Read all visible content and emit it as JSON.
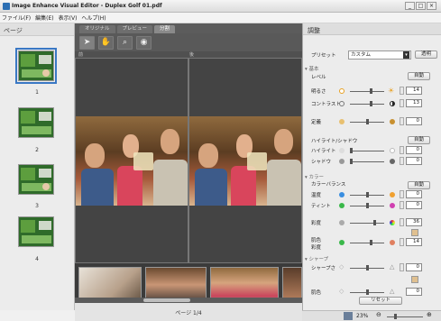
{
  "window": {
    "title": "Image Enhance Visual Editor - Duplex Golf 01.pdf"
  },
  "menu": {
    "items": [
      "ファイル(F)",
      "編集(E)",
      "表示(V)",
      "ヘルプ(H)"
    ]
  },
  "left_panel": {
    "title": "ページ",
    "pages": [
      "1",
      "2",
      "3",
      "4"
    ]
  },
  "center": {
    "tabs": [
      "オリジナル",
      "プレビュー",
      "分割"
    ],
    "ruler": {
      "left": "前",
      "right": "後"
    },
    "page_status": "ページ 1/4"
  },
  "right_panel": {
    "title": "調整",
    "preset_label": "プリセット",
    "preset_value": "カスタム",
    "transparency_button": "透明",
    "sections": {
      "basic": "基本",
      "color": "カラー",
      "sharpness": "シャープ"
    },
    "level_label": "レベル",
    "auto_label": "自動",
    "brightness_label": "明るさ",
    "brightness_value": "14",
    "contrast_label": "コントラスト",
    "contrast_value": "13",
    "definition_label": "定義",
    "definition_value": "0",
    "highlight_shadow_label": "ハイライト/シャドウ",
    "highlight_label": "ハイライト",
    "highlight_value": "0",
    "shadow_label": "シャドウ",
    "shadow_value": "0",
    "color_balance_label": "カラーバランス",
    "temperature_label": "温度",
    "temperature_value": "0",
    "tint_label": "ティント",
    "tint_value": "0",
    "saturation_label": "彩度",
    "saturation_value": "36",
    "skin_saturation_label": "肌色\n彩度",
    "skin_saturation_value": "14",
    "sharpness_label": "シャープさ",
    "sharpness_value": "0",
    "skin_label": "肌色",
    "skin_value": "0",
    "reset_label": "リセット",
    "zoom": "23%"
  },
  "colors": {
    "accent": "#3a78c4",
    "canvas": "#4a4a4a"
  }
}
